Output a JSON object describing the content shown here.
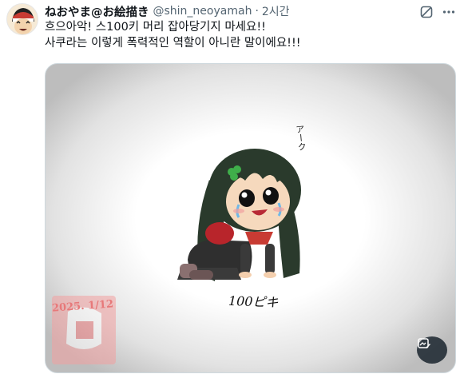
{
  "post": {
    "display_name": "ねおやま@お絵描き",
    "handle": "@shin_neoyamah",
    "separator": "·",
    "time": "2시간",
    "text_lines": [
      "흐으아악! 스100키 머리 잡아당기지 마세요!!",
      "사쿠라는 이렇게 폭력적인 역할이 아니란 말이에요!!!"
    ]
  },
  "media": {
    "drawing_caption": "100ピキ",
    "drawing_sfx": "アーク",
    "stamp_date": "2025. 1/12"
  },
  "icons": {
    "avatar": "avatar-image",
    "grok": "grok-icon",
    "more": "more-icon",
    "alt": "image-edit-icon"
  },
  "colors": {
    "text_primary": "#0f1419",
    "text_secondary": "#536471",
    "border": "#cfd9de",
    "hair": "#2a3a2c",
    "stamp": "#e7797a"
  }
}
